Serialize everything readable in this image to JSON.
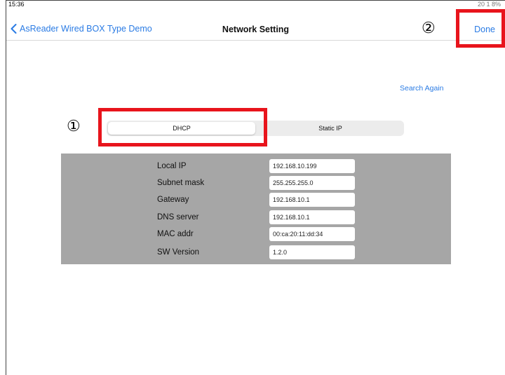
{
  "status": {
    "time": "15:36",
    "right": "20 1 8%"
  },
  "nav": {
    "back_label": "AsReader Wired BOX Type Demo",
    "title": "Network Setting",
    "done_label": "Done"
  },
  "search_again": "Search Again",
  "segments": {
    "dhcp": "DHCP",
    "static": "Static IP",
    "selected": "DHCP"
  },
  "markers": {
    "one": "①",
    "two": "②"
  },
  "colors": {
    "accent": "#2a7be4",
    "highlight": "#e8141c",
    "panel": "#a6a6a6"
  },
  "settings": [
    {
      "label": "Local IP",
      "value": "192.168.10.199"
    },
    {
      "label": "Subnet mask",
      "value": "255.255.255.0"
    },
    {
      "label": "Gateway",
      "value": "192.168.10.1"
    },
    {
      "label": "DNS server",
      "value": "192.168.10.1"
    },
    {
      "label": "MAC addr",
      "value": "00:ca:20:11:dd:34"
    },
    {
      "label": "SW Version",
      "value": "1.2.0"
    }
  ]
}
